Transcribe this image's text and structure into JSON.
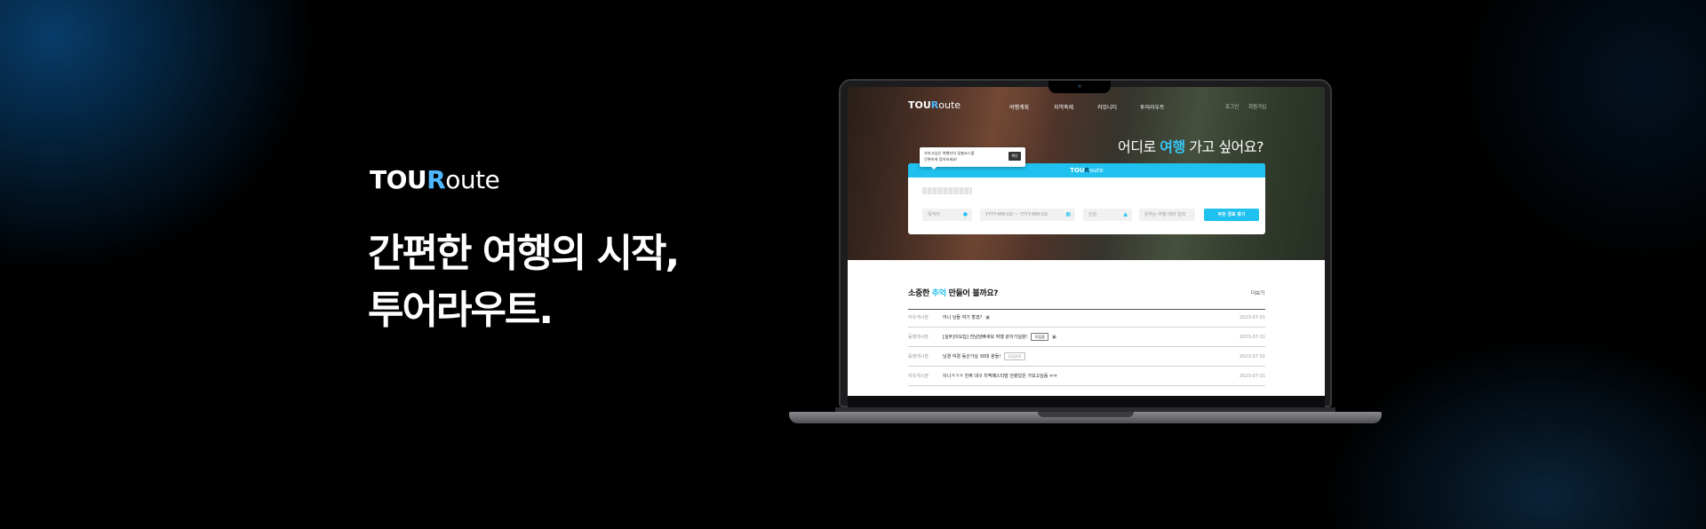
{
  "hero": {
    "logo": {
      "bold": "TOU",
      "r": "R",
      "rest": "oute"
    },
    "headline_line1": "간편한 여행의 시작,",
    "headline_line2": "투어라우트."
  },
  "site": {
    "logo": {
      "bold": "TOU",
      "r": "R",
      "rest": "oute"
    },
    "nav": [
      "여행계획",
      "지역축제",
      "커뮤니티",
      "투어라우트"
    ],
    "auth": {
      "login": "로그인",
      "signup": "회원가입"
    },
    "question": {
      "prefix": "어디로 ",
      "highlight": "여행",
      "suffix": " 가고 싶어요?"
    },
    "tooltip": {
      "line1": "가보고싶은 여행지의 맞춤코스를",
      "line2": "간편하게 찾아보세요!",
      "button": "확인"
    },
    "search_panel": {
      "logo": {
        "bold": "TOU",
        "r": "R",
        "rest": "oute"
      },
      "fields": {
        "destination": "목적지",
        "dates": "YYYY-MM-DD ~ YYYY-MM-DD",
        "people": "인원",
        "theme": "원하는 여행 테마 입력"
      },
      "cta": "추천 경로 찾기"
    },
    "board": {
      "title": {
        "prefix": "소중한 ",
        "highlight": "추억",
        "suffix": " 만들어 볼까요?"
      },
      "more": "더보기",
      "rows": [
        {
          "category": "자유게시판",
          "title": "어니 님들 여기 할겠?",
          "badge": "",
          "date": "2023-07-31"
        },
        {
          "category": "동행게시판",
          "title": "[실주]이모집] 전남담빠새모 여행 같이가실분!",
          "badge": "모집중",
          "date": "2023-07-31"
        },
        {
          "category": "동행게시판",
          "title": "남경 여경 동산가실 30대 분들!",
          "badge": "모집완료",
          "date": "2023-07-31"
        },
        {
          "category": "자유게시판",
          "title": "이니ㅋㅋㅋ 진짜 대구 치맥페스티벌 안봤었은 가보고싶음 ㅠㅠ",
          "badge": "",
          "date": "2023-07-31"
        }
      ]
    }
  },
  "icons": [
    "pin-icon",
    "calendar-icon",
    "person-icon",
    "image-icon"
  ],
  "colors": {
    "accent": "#1fc1ef",
    "logo_r": "#4fb7ff",
    "background": "#000000"
  }
}
